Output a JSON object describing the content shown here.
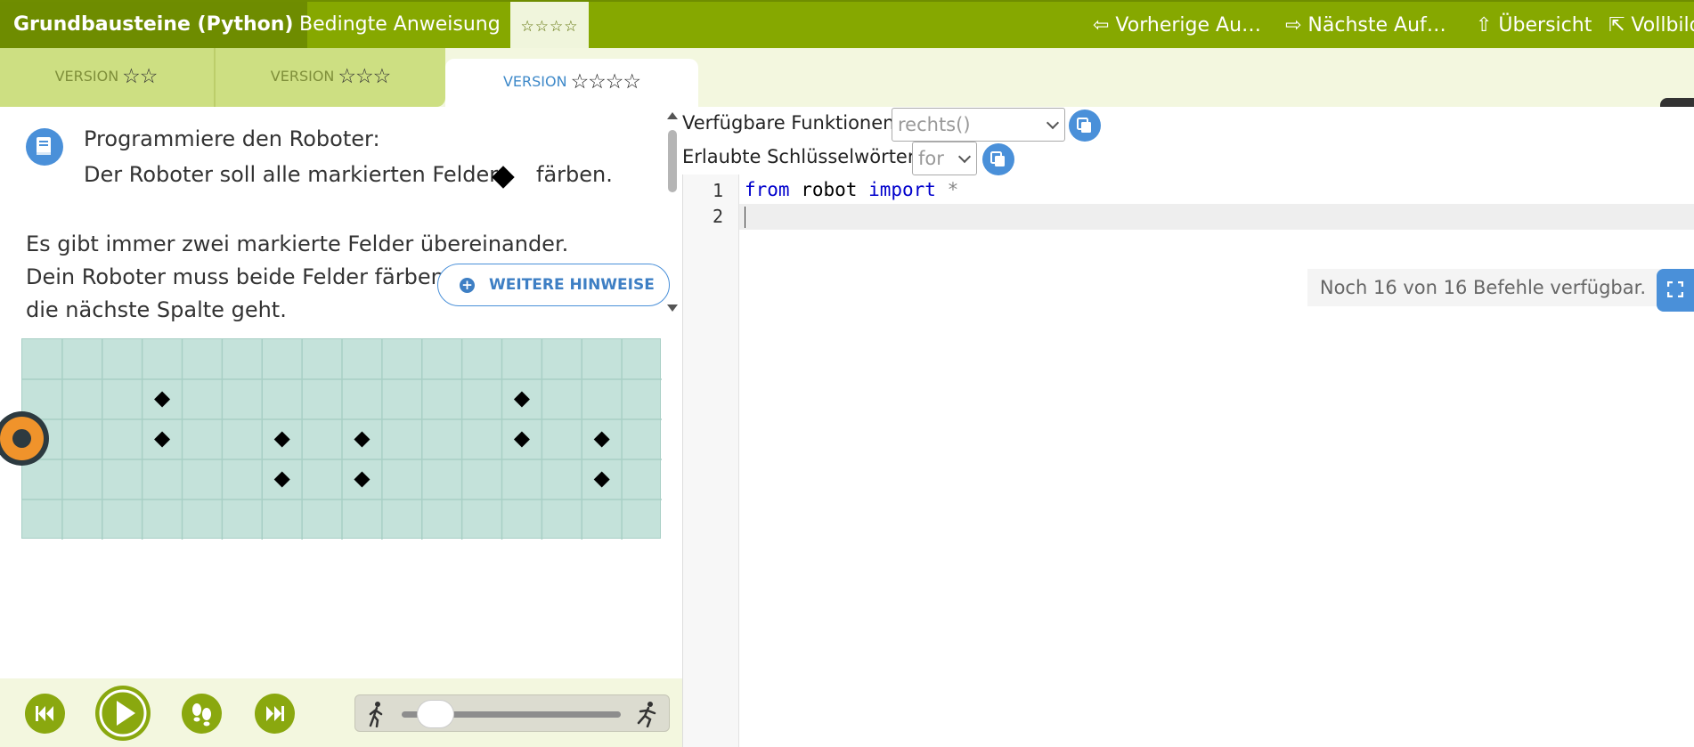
{
  "header": {
    "course_title": "Grundbausteine (Python)",
    "task_title": "Bedingte Anweisung",
    "difficulty": "☆☆☆☆",
    "nav": {
      "prev": "⇦ Vorherige Au…",
      "next": "⇨ Nächste Auf…",
      "overview": "⇧ Übersicht",
      "fullscreen": "⇱ Vollbild"
    }
  },
  "versions": {
    "label": "VERSION",
    "tabs": [
      {
        "stars": "☆☆",
        "active": false
      },
      {
        "stars": "☆☆☆",
        "active": false
      },
      {
        "stars": "☆☆☆☆",
        "active": true
      }
    ],
    "menu_icon": "≡"
  },
  "instructions": {
    "line1": "Programmiere den Roboter:",
    "line2_before": "Der Roboter soll alle markierten Felder",
    "line2_after": "färben.",
    "hint": "Es gibt immer zwei markierte Felder übereinander. Dein Roboter muss beide Felder färben, bevor er in die nächste Spalte geht.",
    "hint_button": "WEITERE HINWEISE",
    "icon": "book-icon"
  },
  "grid": {
    "cols": 16,
    "rows": 5,
    "cell_color": "#c4e2da",
    "line_color": "#a8cfc5",
    "marked": [
      [
        3,
        1
      ],
      [
        3,
        2
      ],
      [
        6,
        2
      ],
      [
        6,
        3
      ],
      [
        8,
        2
      ],
      [
        8,
        3
      ],
      [
        12,
        1
      ],
      [
        12,
        2
      ],
      [
        14,
        2
      ],
      [
        14,
        3
      ]
    ],
    "robot": {
      "col": 0,
      "row": 2
    }
  },
  "controls": {
    "buttons": [
      "rewind",
      "play",
      "step",
      "fast-forward"
    ],
    "speed_value": 0.1
  },
  "editor": {
    "functions_label": "Verfügbare Funktionen:",
    "functions_selected": "rechts()",
    "keywords_label": "Erlaubte Schlüsselwörter:",
    "keywords_selected": "for",
    "line_numbers": [
      "1",
      "2"
    ],
    "code_from": "from",
    "code_module": " robot ",
    "code_import": "import",
    "code_star": " *",
    "command_count": "Noch 16 von 16 Befehle verfügbar."
  },
  "colors": {
    "brand_green": "#86a800",
    "accent_blue": "#4a90d9",
    "robot_orange": "#f0932b"
  }
}
